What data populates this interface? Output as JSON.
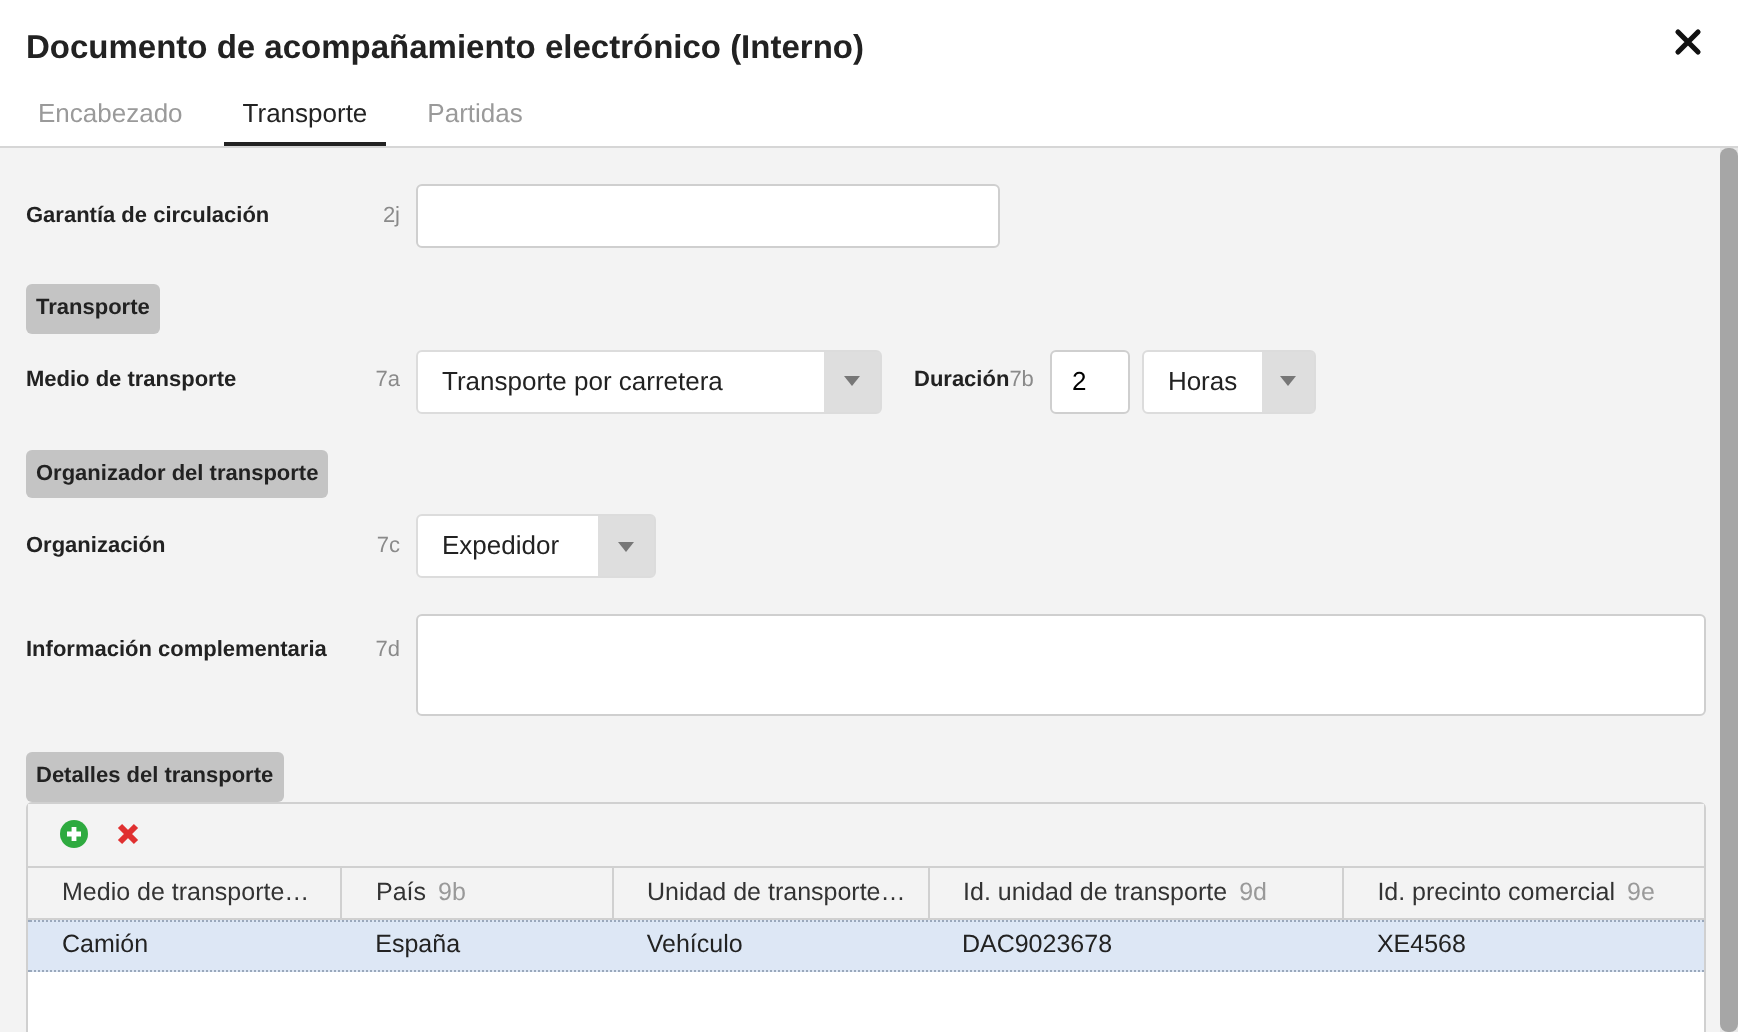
{
  "dialog": {
    "title": "Documento de acompañamiento electrónico (Interno)"
  },
  "tabs": [
    {
      "label": "Encabezado",
      "selected": false
    },
    {
      "label": "Transporte",
      "selected": true
    },
    {
      "label": "Partidas",
      "selected": false
    }
  ],
  "form": [
    {
      "kind": "field",
      "label": "Garantía de circulación",
      "code": "2j",
      "controls": [
        {
          "kind": "text"
        }
      ]
    },
    {
      "kind": "section",
      "label": "Transporte"
    },
    {
      "kind": "field",
      "label": "Medio de transporte",
      "code": "7a",
      "controls": [
        {
          "kind": "select",
          "value": "Transporte por carretera"
        },
        {
          "kind": "label",
          "label": "Duración",
          "code": "7b"
        },
        {
          "kind": "text",
          "value": "2"
        },
        {
          "kind": "select",
          "value": "Horas"
        }
      ]
    },
    {
      "kind": "section",
      "label": "Organizador del transporte"
    },
    {
      "kind": "field",
      "label": "Organización",
      "code": "7c",
      "controls": [
        {
          "kind": "select",
          "value": "Expedidor"
        }
      ]
    },
    {
      "kind": "field",
      "label": "Información complementaria",
      "code": "7d",
      "controls": [
        {
          "kind": "textarea"
        }
      ]
    },
    {
      "kind": "section",
      "label": "Detalles del transporte"
    }
  ],
  "grid": {
    "columns": [
      {
        "label": "Medio de transporte…"
      },
      {
        "label": "País",
        "code": "9b"
      },
      {
        "label": "Unidad de transporte…"
      },
      {
        "label": "Id. unidad de transporte",
        "code": "9d"
      },
      {
        "label": "Id. precinto comercial",
        "code": "9e"
      }
    ],
    "rows": [
      {
        "selected": true,
        "cells": [
          "Camión",
          "España",
          "Vehículo",
          "DAC9023678",
          "XE4568"
        ]
      }
    ]
  }
}
